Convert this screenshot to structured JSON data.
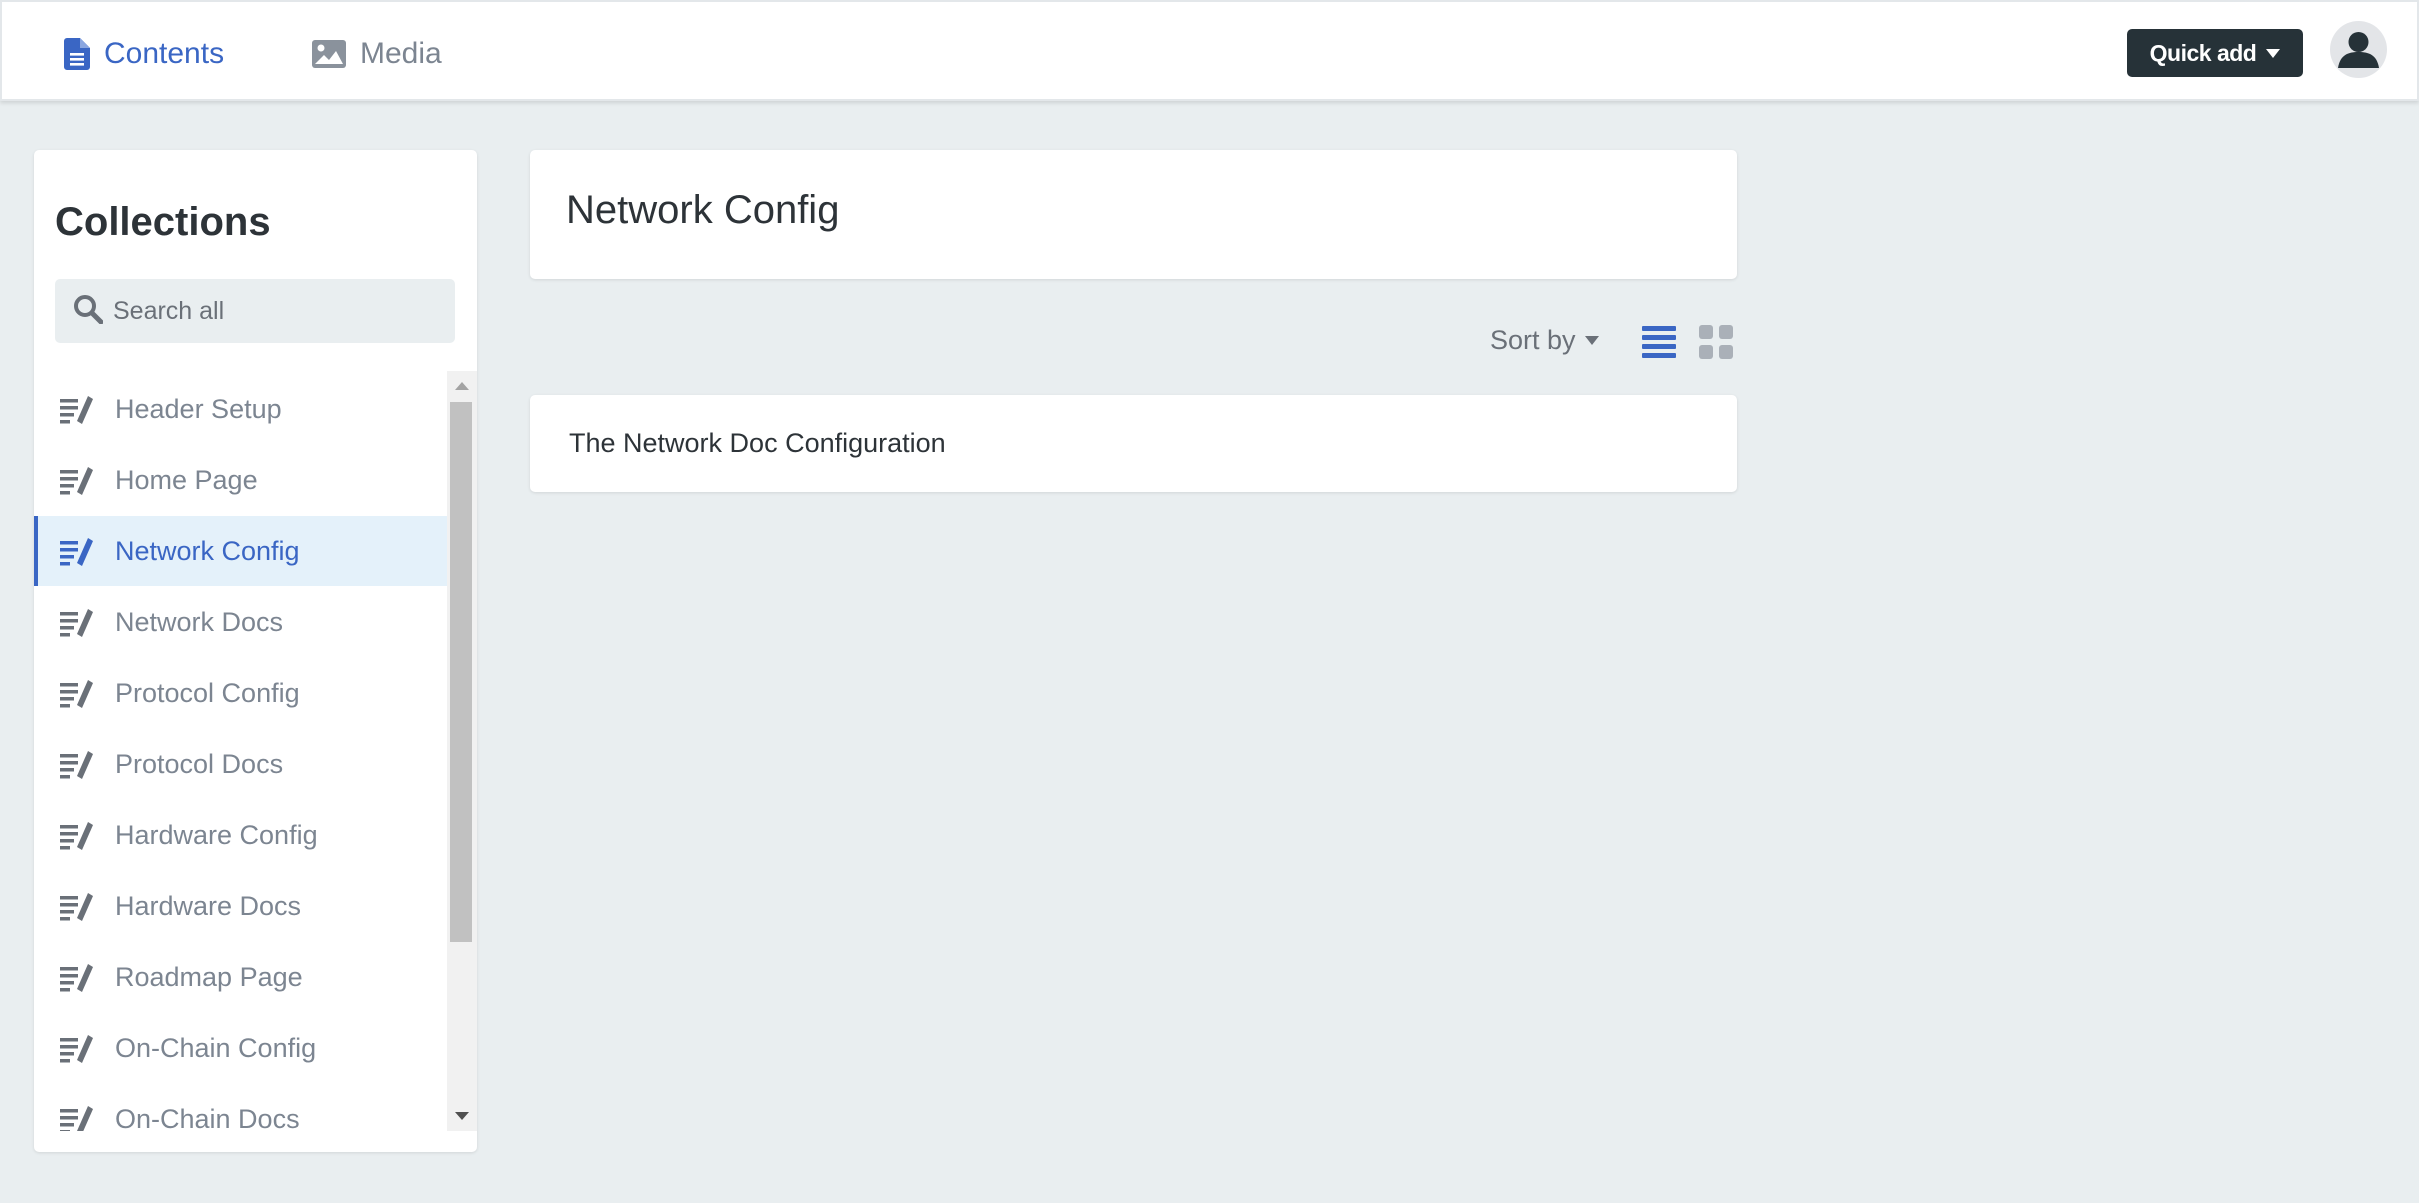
{
  "nav": {
    "contents_label": "Contents",
    "media_label": "Media",
    "quick_add_label": "Quick add"
  },
  "sidebar": {
    "title": "Collections",
    "search_placeholder": "Search all",
    "items": [
      {
        "label": "Header Setup",
        "active": false
      },
      {
        "label": "Home Page",
        "active": false
      },
      {
        "label": "Network Config",
        "active": true
      },
      {
        "label": "Network Docs",
        "active": false
      },
      {
        "label": "Protocol Config",
        "active": false
      },
      {
        "label": "Protocol Docs",
        "active": false
      },
      {
        "label": "Hardware Config",
        "active": false
      },
      {
        "label": "Hardware Docs",
        "active": false
      },
      {
        "label": "Roadmap Page",
        "active": false
      },
      {
        "label": "On-Chain Config",
        "active": false
      },
      {
        "label": "On-Chain Docs",
        "active": false
      }
    ]
  },
  "main": {
    "title": "Network Config",
    "sort_label": "Sort by",
    "entries": [
      {
        "title": "The Network Doc Configuration"
      }
    ]
  },
  "colors": {
    "accent": "#3a66c4",
    "dark_button": "#263238",
    "background": "#e9eef0",
    "active_row": "#e4f1fa"
  },
  "icons": {
    "contents": "document-icon",
    "media": "image-icon",
    "search": "search-icon",
    "collection": "list-edit-icon",
    "avatar": "user-avatar-icon",
    "list_view": "list-view-icon",
    "grid_view": "grid-view-icon"
  }
}
